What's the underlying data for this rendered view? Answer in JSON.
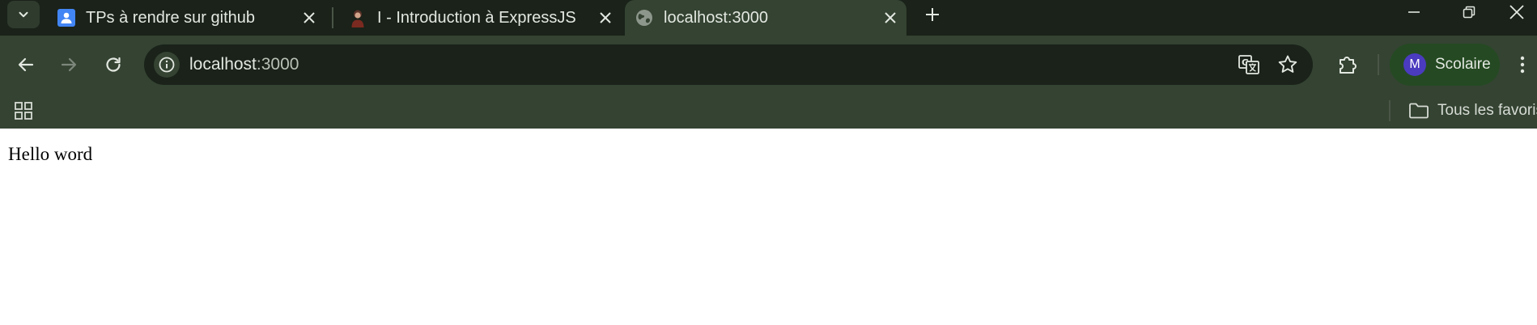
{
  "tabs": [
    {
      "title": "TPs à rendre sur github",
      "favicon": "classroom-icon",
      "active": false
    },
    {
      "title": "I - Introduction à ExpressJS",
      "favicon": "avatar-favicon",
      "active": false
    },
    {
      "title": "localhost:3000",
      "favicon": "globe-icon",
      "active": true
    }
  ],
  "omnibox": {
    "host": "localhost",
    "port": ":3000"
  },
  "profile": {
    "initial": "M",
    "name": "Scolaire"
  },
  "bookmarks_bar": {
    "all_bookmarks_label": "Tous les favoris"
  },
  "page": {
    "body_text": "Hello word"
  },
  "colors": {
    "frame": "#1a2219",
    "toolbar": "#344332",
    "profile_chip": "#254a23",
    "avatar": "#4a3bbf",
    "text": "#e3e8e1"
  }
}
